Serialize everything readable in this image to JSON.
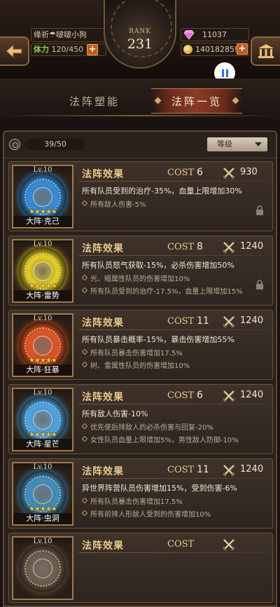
{
  "header": {
    "player_name": "缘祈☂啵啵小狗",
    "stamina_label": "体力",
    "stamina_value": "120/450",
    "rank_label": "RANK",
    "rank_value": "231",
    "gems": "11037",
    "gold": "140182859",
    "plus": "+"
  },
  "tabs": [
    {
      "label": "法阵塑能",
      "active": false
    },
    {
      "label": "法阵一览",
      "active": true
    }
  ],
  "list": {
    "count": "39/50",
    "sort_label": "等级"
  },
  "cards": [
    {
      "level": "Lv.10",
      "name": "大阵·克己",
      "stars": "★★★★★",
      "title": "法阵效果",
      "cost_label": "COST",
      "cost": "6",
      "power": "930",
      "main_effect": "所有队员受到的治疗-35%，血量上限增加30%",
      "sub_effects": [
        "所有敌人伤害-5%"
      ],
      "circle_color": "#2f8ee0",
      "locked": true
    },
    {
      "level": "Lv.10",
      "name": "大阵·雷势",
      "stars": "★★★★★",
      "title": "法阵效果",
      "cost_label": "COST",
      "cost": "8",
      "power": "1240",
      "main_effect": "所有队员怒气获取-15%，必杀伤害增加50%",
      "sub_effects": [
        "光、暗属性队员的伤害增加10%",
        "所有队员受到的治疗-17.5%，血量上限增加15%"
      ],
      "circle_color": "#e8d21c",
      "locked": true
    },
    {
      "level": "Lv.10",
      "name": "大阵·狂暴",
      "stars": "★★★★★",
      "title": "法阵效果",
      "cost_label": "COST",
      "cost": "11",
      "power": "1240",
      "main_effect": "所有队员暴击概率-15%，暴击伤害增加55%",
      "sub_effects": [
        "所有队员暴击伤害增加17.5%",
        "树、雷属性队员的伤害增加10%"
      ],
      "circle_color": "#e8501c",
      "locked": false
    },
    {
      "level": "Lv.10",
      "name": "大阵·星芒",
      "stars": "★★★★★",
      "title": "法阵效果",
      "cost_label": "COST",
      "cost": "6",
      "power": "1240",
      "main_effect": "所有敌人伤害-10%",
      "sub_effects": [
        "优先使后排敌人的必杀伤害与回复-20%",
        "女性队员血量上限增加5%，男性敌人防御-10%"
      ],
      "circle_color": "#48a8e8",
      "locked": false
    },
    {
      "level": "Lv.10",
      "name": "大阵·虫洞",
      "stars": "★★★★★",
      "title": "法阵效果",
      "cost_label": "COST",
      "cost": "11",
      "power": "1240",
      "main_effect": "异世界阵营队员伤害增加15%，受到伤害-6%",
      "sub_effects": [
        "所有队员暴击伤害增加17.5%",
        "所有前排人形敌人受到的伤害增加10%"
      ],
      "circle_color": "#3e8fc0",
      "locked": false
    },
    {
      "level": "Lv.10",
      "name": "",
      "stars": "",
      "title": "法阵效果",
      "cost_label": "COST",
      "cost": "",
      "power": "",
      "main_effect": "",
      "sub_effects": [],
      "circle_color": "#6a5a48",
      "locked": false
    }
  ]
}
